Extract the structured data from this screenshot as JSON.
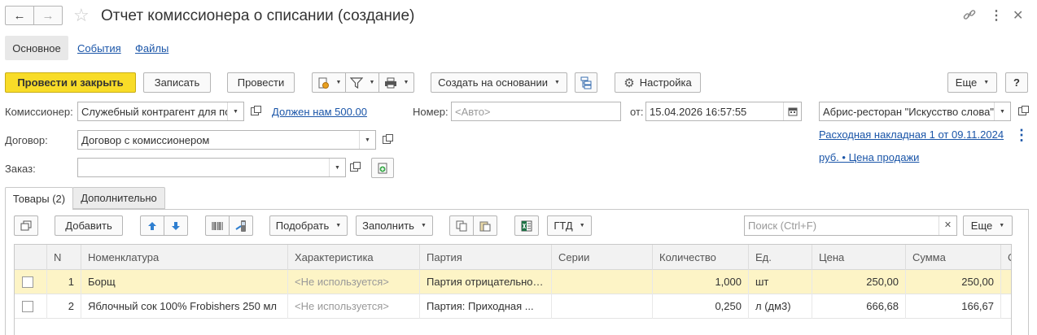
{
  "window": {
    "title": "Отчет комиссионера о списании (создание)"
  },
  "nav": {
    "tabs": [
      "Основное",
      "События",
      "Файлы"
    ]
  },
  "toolbar": {
    "post_close": "Провести и закрыть",
    "write": "Записать",
    "post": "Провести",
    "create_based": "Создать на основании",
    "settings": "Настройка",
    "more": "Еще",
    "help": "?"
  },
  "form": {
    "commissioner_label": "Комиссионер:",
    "commissioner_value": "Служебный контрагент для по",
    "debt_link": "Должен нам 500.00",
    "number_label": "Номер:",
    "number_placeholder": "<Авто>",
    "date_label": "от:",
    "date_value": "15.04.2026 16:57:55",
    "org_value": "Абрис-ресторан \"Искусство слова\"",
    "contract_label": "Договор:",
    "contract_value": "Договор с комиссионером",
    "order_label": "Заказ:",
    "order_value": "",
    "invoice_link": "Расходная накладная 1 от 09.11.2024",
    "price_link": "руб. • Цена продажи"
  },
  "tabs": {
    "goods": "Товары (2)",
    "extra": "Дополнительно"
  },
  "table_toolbar": {
    "add": "Добавить",
    "pick": "Подобрать",
    "fill": "Заполнить",
    "gtd": "ГТД",
    "search_placeholder": "Поиск (Ctrl+F)",
    "more": "Еще"
  },
  "table": {
    "headers": [
      "N",
      "Номенклатура",
      "Характеристика",
      "Партия",
      "Серии",
      "Количество",
      "Ед.",
      "Цена",
      "Сумма",
      "С"
    ],
    "rows": [
      {
        "n": "1",
        "name": "Борщ",
        "char": "<Не используется>",
        "batch": "Партия отрицательной...",
        "series": "",
        "qty": "1,000",
        "unit": "шт",
        "price": "250,00",
        "sum": "250,00"
      },
      {
        "n": "2",
        "name": "Яблочный сок 100% Frobishers 250 мл",
        "char": "<Не используется>",
        "batch": "Партия: Приходная ...",
        "series": "",
        "qty": "0,250",
        "unit": "л (дм3)",
        "price": "666,68",
        "sum": "166,67"
      }
    ]
  },
  "colors": {
    "accent": "#f8dc28",
    "selected_row": "#fdf4c6",
    "link": "#1a55a8"
  }
}
